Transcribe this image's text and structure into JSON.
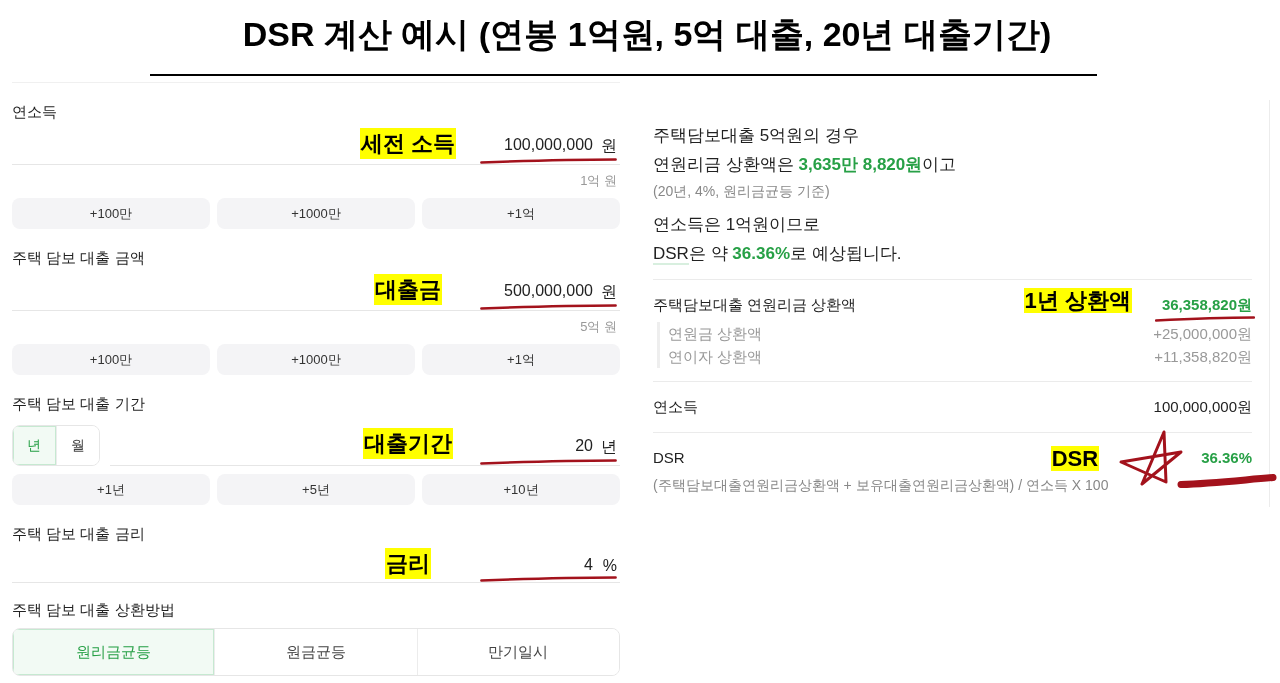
{
  "title": "DSR 계산 예시 (연봉 1억원, 5억 대출, 20년 대출기간)",
  "form": {
    "fields": [
      {
        "kind": "amount",
        "label": "연소득",
        "value": "100,000,000",
        "unit": "원",
        "annotation": {
          "label": "세전 소득",
          "kind": "underline"
        },
        "hint": "1억 원",
        "quick_buttons": [
          "+100만",
          "+1000만",
          "+1억"
        ]
      },
      {
        "kind": "amount",
        "label": "주택 담보 대출 금액",
        "value": "500,000,000",
        "unit": "원",
        "annotation": {
          "label": "대출금",
          "kind": "underline"
        },
        "hint": "5억 원",
        "quick_buttons": [
          "+100만",
          "+1000만",
          "+1억"
        ]
      },
      {
        "kind": "period",
        "label": "주택 담보 대출 기간",
        "unit_options": [
          {
            "label": "년",
            "selected": true
          },
          {
            "label": "월",
            "selected": false
          }
        ],
        "value": "20",
        "unit": "년",
        "annotation": {
          "label": "대출기간",
          "kind": "underline"
        },
        "quick_buttons": [
          "+1년",
          "+5년",
          "+10년"
        ]
      },
      {
        "kind": "rate",
        "label": "주택 담보 대출 금리",
        "value": "4",
        "unit": "%",
        "annotation": {
          "label": "금리",
          "kind": "underline"
        }
      },
      {
        "kind": "choice",
        "label": "주택 담보 대출 상환방법",
        "options": [
          {
            "label": "원리금균등",
            "selected": true
          },
          {
            "label": "원금균등",
            "selected": false
          },
          {
            "label": "만기일시",
            "selected": false
          }
        ]
      }
    ]
  },
  "summary": [
    {
      "kind": "sentence",
      "parts": [
        {
          "text": "주택담보대출 5억원의 경우",
          "highlight": false,
          "underlined": false
        }
      ]
    },
    {
      "kind": "sentence",
      "parts": [
        {
          "text": "연원리금 상환액은 ",
          "highlight": false,
          "underlined": false
        },
        {
          "text": "3,635만 8,820원",
          "highlight": true,
          "underlined": false
        },
        {
          "text": "이고",
          "highlight": false,
          "underlined": false
        }
      ]
    },
    {
      "kind": "note",
      "text": "(20년, 4%, 원리금균등 기준)"
    },
    {
      "kind": "sentence",
      "parts": [
        {
          "text": "연소득은 1억원이므로",
          "highlight": false,
          "underlined": false
        }
      ]
    },
    {
      "kind": "sentence",
      "parts": [
        {
          "text": "DSR",
          "highlight": false,
          "underlined": true
        },
        {
          "text": "은 약 ",
          "highlight": false,
          "underlined": false
        },
        {
          "text": "36.36%",
          "highlight": true,
          "underlined": false
        },
        {
          "text": "로 예상됩니다.",
          "highlight": false,
          "underlined": false
        }
      ]
    }
  ],
  "breakdown": {
    "rows": [
      {
        "label": "주택담보대출 연원리금 상환액",
        "value": "36,358,820원",
        "highlight": true,
        "annotation": {
          "label": "1년 상환액",
          "kind": "underline"
        },
        "items": [
          {
            "label": "연원금 상환액",
            "value": "+25,000,000원"
          },
          {
            "label": "연이자 상환액",
            "value": "+11,358,820원"
          }
        ]
      },
      {
        "label": "연소득",
        "value": "100,000,000원",
        "highlight": false
      },
      {
        "label": "DSR",
        "value": "36.36%",
        "highlight": true,
        "annotation": {
          "label": "DSR",
          "kind": "star"
        },
        "formula": "(주택담보대출연원리금상환액 + 보유대출연원리금상환액) / 연소득 X 100"
      }
    ]
  }
}
